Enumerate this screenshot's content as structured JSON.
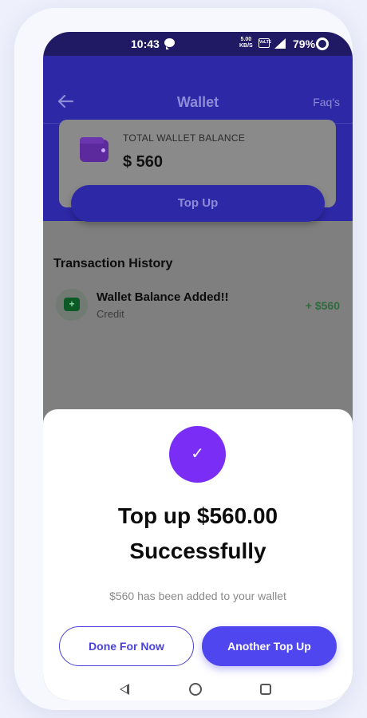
{
  "status_bar": {
    "time": "10:43",
    "speed": "5.00",
    "speed_unit": "KB/S",
    "volte": "VoLTE",
    "battery": "79%"
  },
  "header": {
    "title": "Wallet",
    "faqs_label": "Faq's",
    "back_icon": "arrow-left-icon",
    "color": "#2d28a6"
  },
  "wallet_card": {
    "label": "TOTAL WALLET BALANCE",
    "amount": "$ 560",
    "icon": "wallet-icon",
    "topup_label": "Top Up"
  },
  "transactions": {
    "heading": "Transaction History",
    "items": [
      {
        "title": "Wallet Balance Added!!",
        "type": "Credit",
        "amount": "+ $560",
        "icon": "wallet-add-icon",
        "amount_color": "#2f6b3c"
      }
    ]
  },
  "success_sheet": {
    "check_icon": "check-icon",
    "title_line1": "Top up $560.00",
    "title_line2": "Successfully",
    "subtitle": "$560 has been added to your wallet",
    "done_label": "Done For Now",
    "another_label": "Another Top Up",
    "accent": "#7a2ef5",
    "primary": "#4f46f0"
  },
  "nav_bar": {
    "back_icon": "nav-back-icon",
    "home_icon": "nav-home-icon",
    "recent_icon": "nav-recents-icon"
  }
}
